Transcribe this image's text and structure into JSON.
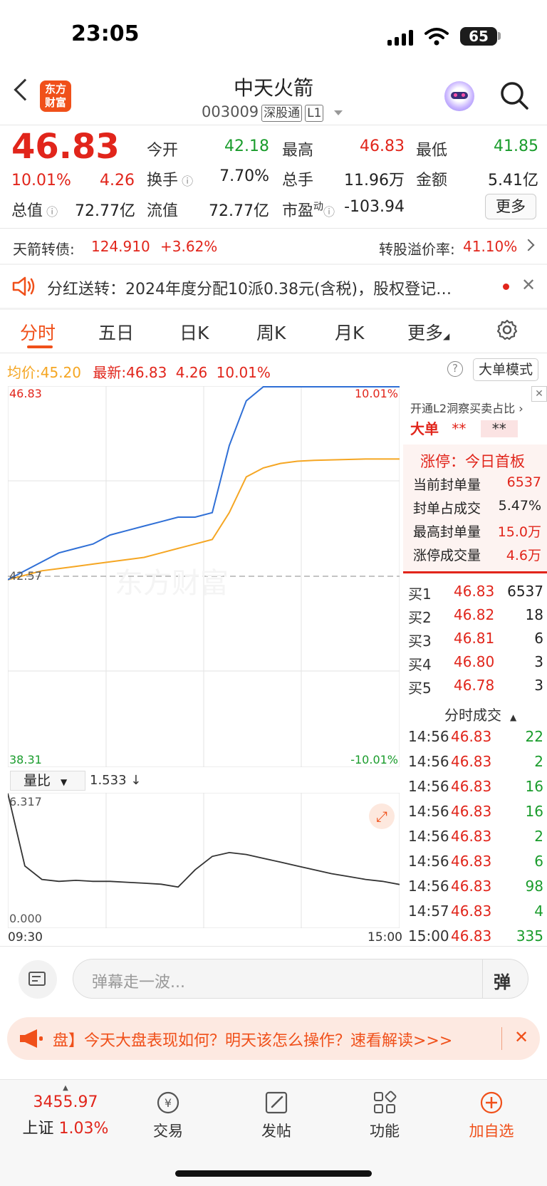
{
  "status_bar": {
    "time": "23:05",
    "battery": "65"
  },
  "header": {
    "logo_text": "东方财富",
    "stock_name": "中天火箭",
    "stock_code": "003009",
    "tag_connect": "深股通",
    "tag_level": "L1"
  },
  "quote": {
    "price": "46.83",
    "change_pct": "10.01%",
    "change": "4.26",
    "open_label": "今开",
    "open": "42.18",
    "high_label": "最高",
    "high": "46.83",
    "low_label": "最低",
    "low": "41.85",
    "turnover_label": "换手",
    "turnover": "7.70%",
    "volume_label": "总手",
    "volume": "11.96万",
    "amount_label": "金额",
    "amount": "5.41亿",
    "mktcap_label": "总值",
    "mktcap": "72.77亿",
    "float_label": "流值",
    "float_cap": "72.77亿",
    "pe_label": "市盈",
    "pe_sup": "动",
    "pe": "-103.94",
    "more": "更多"
  },
  "bond": {
    "label": "天箭转债:",
    "price": "124.910",
    "change": "+3.62%",
    "premium_label": "转股溢价率:",
    "premium": "41.10%"
  },
  "notice": {
    "text": "分红送转：2024年度分配10派0.38元(含税)，股权登记…"
  },
  "tabs": [
    "分时",
    "五日",
    "日K",
    "周K",
    "月K",
    "更多"
  ],
  "chart_header": {
    "avg_label": "均价:",
    "avg": "45.20",
    "latest_label": "最新:",
    "latest": "46.83",
    "latest_change": "4.26",
    "latest_pct": "10.01%",
    "mode_btn": "大单模式"
  },
  "chart_labels": {
    "top_price": "46.83",
    "top_pct": "10.01%",
    "mid_price": "42.57",
    "bottom_price": "38.31",
    "bottom_pct": "-10.01%",
    "vr_selector": "量比",
    "vr_value": "1.533",
    "vr_max": "6.317",
    "vr_min": "0.000",
    "time_start": "09:30",
    "time_end": "15:00",
    "watermark": "东方财富"
  },
  "chart_data": {
    "type": "line",
    "ylim": [
      38.31,
      46.83
    ],
    "series": [
      {
        "values": [
          42.5,
          42.7,
          42.9,
          43.1,
          43.2,
          43.3,
          43.5,
          43.6,
          43.7,
          43.8,
          43.9,
          43.9,
          44.0,
          45.5,
          46.5,
          46.83,
          46.83,
          46.83,
          46.83,
          46.83,
          46.83,
          46.83,
          46.83,
          46.83
        ]
      },
      {
        "values": [
          42.5,
          42.6,
          42.7,
          42.75,
          42.8,
          42.85,
          42.9,
          42.95,
          43.0,
          43.1,
          43.2,
          43.3,
          43.4,
          44.0,
          44.8,
          45.0,
          45.1,
          45.15,
          45.17,
          45.18,
          45.19,
          45.2,
          45.2,
          45.2
        ]
      }
    ],
    "volume_ratio": {
      "ylim": [
        0,
        6.317
      ],
      "values": [
        6.317,
        2.5,
        1.8,
        1.7,
        1.75,
        1.7,
        1.7,
        1.65,
        1.6,
        1.55,
        1.4,
        2.3,
        3.0,
        3.2,
        3.1,
        2.9,
        2.7,
        2.5,
        2.3,
        2.1,
        1.95,
        1.8,
        1.7,
        1.533
      ]
    }
  },
  "l2_panel": {
    "promo": "开通L2洞察买卖占比",
    "big_order_label": "大单",
    "big_val1": "**",
    "big_val2": "**",
    "limit_title": "涨停：今日首板",
    "rows": [
      {
        "label": "当前封单量",
        "value": "6537"
      },
      {
        "label": "封单占成交",
        "value": "5.47%"
      },
      {
        "label": "最高封单量",
        "value": "15.0万"
      },
      {
        "label": "涨停成交量",
        "value": "4.6万"
      }
    ]
  },
  "order_book": [
    {
      "label": "买1",
      "price": "46.83",
      "qty": "6537"
    },
    {
      "label": "买2",
      "price": "46.82",
      "qty": "18"
    },
    {
      "label": "买3",
      "price": "46.81",
      "qty": "6"
    },
    {
      "label": "买4",
      "price": "46.80",
      "qty": "3"
    },
    {
      "label": "买5",
      "price": "46.78",
      "qty": "3"
    }
  ],
  "ticks_title": "分时成交",
  "ticks": [
    {
      "time": "14:56",
      "price": "46.83",
      "vol": "22"
    },
    {
      "time": "14:56",
      "price": "46.83",
      "vol": "2"
    },
    {
      "time": "14:56",
      "price": "46.83",
      "vol": "16"
    },
    {
      "time": "14:56",
      "price": "46.83",
      "vol": "16"
    },
    {
      "time": "14:56",
      "price": "46.83",
      "vol": "2"
    },
    {
      "time": "14:56",
      "price": "46.83",
      "vol": "6"
    },
    {
      "time": "14:56",
      "price": "46.83",
      "vol": "98"
    },
    {
      "time": "14:57",
      "price": "46.83",
      "vol": "4"
    },
    {
      "time": "15:00",
      "price": "46.83",
      "vol": "335"
    }
  ],
  "danmaku": {
    "placeholder": "弹幕走一波...",
    "send": "弹"
  },
  "banner": {
    "text": "盘】今天大盘表现如何？明天该怎么操作？速看解读>>>"
  },
  "bottom_nav": {
    "index_value": "3455.97",
    "index_name": "上证",
    "index_pct": "1.03%",
    "trade": "交易",
    "post": "发帖",
    "func": "功能",
    "add": "加自选"
  }
}
